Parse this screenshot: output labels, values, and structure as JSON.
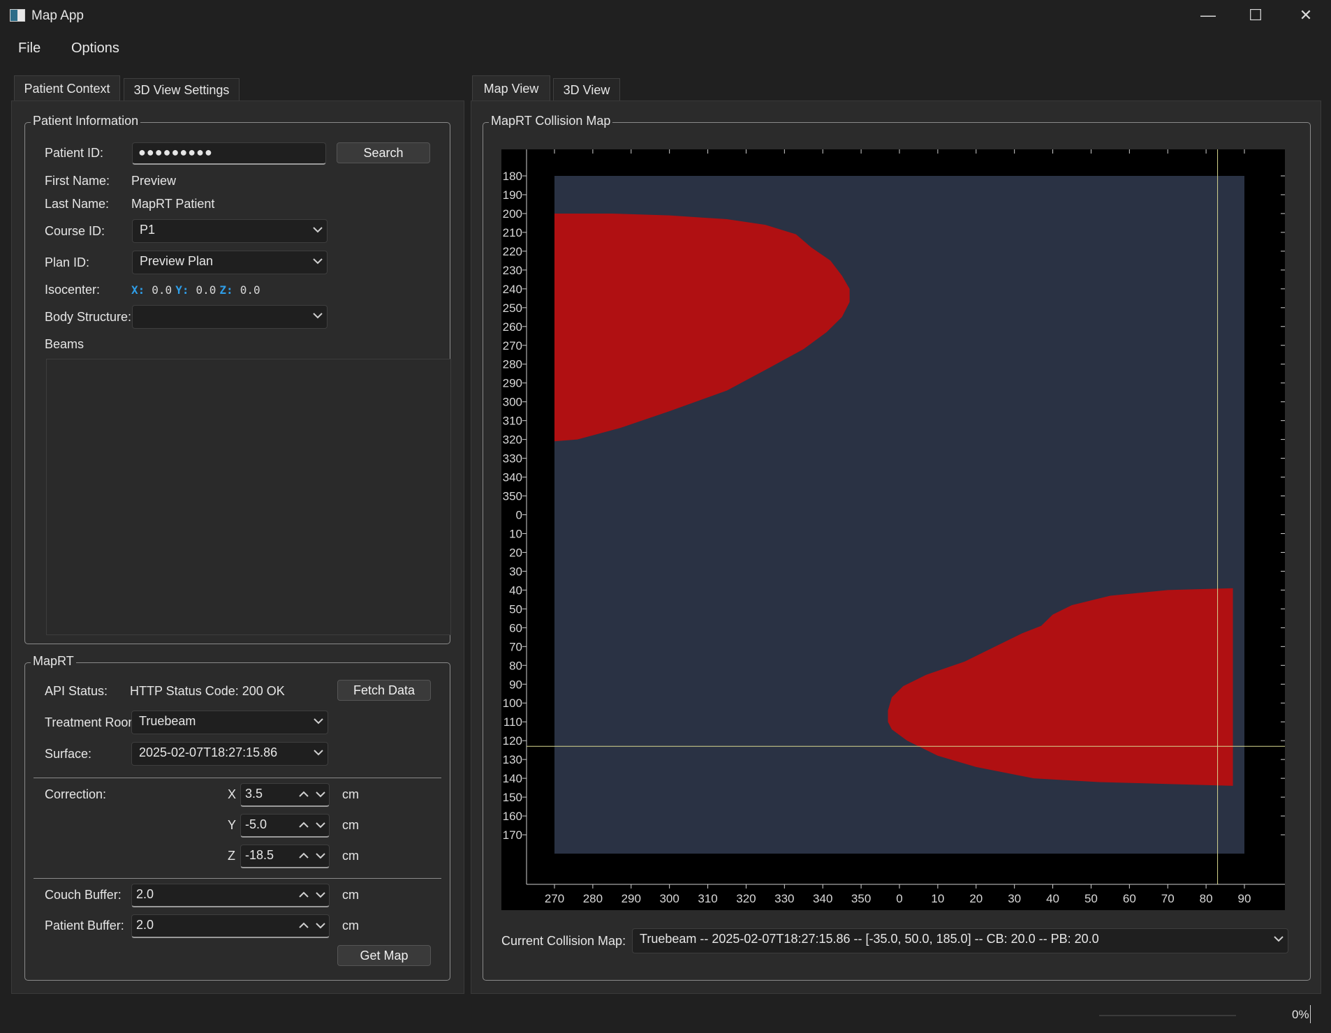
{
  "window": {
    "title": "Map App",
    "controls": {
      "minimize": "—",
      "maximize": "☐",
      "close": "✕"
    }
  },
  "menu": {
    "file": "File",
    "options": "Options"
  },
  "left_tabs": [
    {
      "label": "Patient Context",
      "active": true
    },
    {
      "label": "3D View Settings",
      "active": false
    }
  ],
  "right_tabs": [
    {
      "label": "Map View",
      "active": true
    },
    {
      "label": "3D View",
      "active": false
    }
  ],
  "patient": {
    "group_title": "Patient Information",
    "patient_id_label": "Patient ID:",
    "patient_id_value": "●●●●●●●●●",
    "search_button": "Search",
    "first_name_label": "First Name:",
    "first_name_value": "Preview",
    "last_name_label": "Last Name:",
    "last_name_value": "MapRT Patient",
    "course_id_label": "Course ID:",
    "course_id_value": "P1",
    "plan_id_label": "Plan ID:",
    "plan_id_value": "Preview Plan",
    "isocenter_label": "Isocenter:",
    "iso_x_key": "X:",
    "iso_x": "0.0",
    "iso_y_key": "Y:",
    "iso_y": "0.0",
    "iso_z_key": "Z:",
    "iso_z": "0.0",
    "body_structure_label": "Body Structure:",
    "body_structure_value": "",
    "beams_label": "Beams"
  },
  "maprt": {
    "group_title": "MapRT",
    "api_status_label": "API Status:",
    "api_status_value": "HTTP Status Code: 200 OK",
    "fetch_button": "Fetch Data",
    "room_label": "Treatment Room:",
    "room_value": "Truebeam",
    "surface_label": "Surface:",
    "surface_value": "2025-02-07T18:27:15.86",
    "correction_label": "Correction:",
    "corr_x_label": "X",
    "corr_x": "3.5",
    "corr_y_label": "Y",
    "corr_y": "-5.0",
    "corr_z_label": "Z",
    "corr_z": "-18.5",
    "unit": "cm",
    "couch_buffer_label": "Couch Buffer:",
    "couch_buffer": "2.0",
    "patient_buffer_label": "Patient Buffer:",
    "patient_buffer": "2.0",
    "get_map_button": "Get Map"
  },
  "map": {
    "group_title": "MapRT Collision Map",
    "current_label": "Current Collision Map:",
    "current_value": "Truebeam -- 2025-02-07T18:27:15.86 -- [-35.0, 50.0, 185.0] -- CB: 20.0 -- PB: 20.0"
  },
  "status": {
    "progress": "0%",
    "progress_fraction": 0
  },
  "chart_data": {
    "type": "heatmap",
    "x_tick_labels": [
      "270",
      "280",
      "290",
      "300",
      "310",
      "320",
      "330",
      "340",
      "350",
      "0",
      "10",
      "20",
      "30",
      "40",
      "50",
      "60",
      "70",
      "80",
      "90"
    ],
    "y_tick_labels": [
      "180",
      "190",
      "200",
      "210",
      "220",
      "230",
      "240",
      "250",
      "260",
      "270",
      "280",
      "290",
      "300",
      "310",
      "320",
      "330",
      "340",
      "350",
      "0",
      "10",
      "20",
      "30",
      "40",
      "50",
      "60",
      "70",
      "80",
      "90",
      "100",
      "110",
      "120",
      "130",
      "140",
      "150",
      "160",
      "170"
    ],
    "xlim": [
      270,
      450
    ],
    "ylim": [
      180,
      540
    ],
    "cursor": {
      "x": 83,
      "y": 123
    },
    "colors": {
      "background": "#000000",
      "free": "#2a3244",
      "collision": "#b01012",
      "cursor": "#d8d890",
      "axis": "#d0d0d0"
    },
    "collision_regions": [
      {
        "name": "upper-left",
        "x": [
          270,
          270,
          285,
          300,
          315,
          325,
          333,
          337,
          342,
          345,
          347,
          347,
          345,
          341,
          335,
          326,
          315,
          300,
          287,
          276,
          270
        ],
        "y": [
          200,
          200,
          200,
          201,
          203,
          206,
          211,
          218,
          225,
          233,
          240,
          247,
          255,
          263,
          272,
          282,
          294,
          305,
          314,
          320,
          321
        ]
      },
      {
        "name": "lower-right",
        "x": [
          447,
          447,
          430,
          415,
          405,
          400,
          397,
          392,
          385,
          377,
          367,
          361,
          358,
          357,
          357,
          358,
          362,
          370,
          380,
          395,
          412,
          430,
          447
        ],
        "y": [
          399,
          399,
          400,
          403,
          408,
          413,
          419,
          423,
          430,
          438,
          445,
          451,
          457,
          464,
          470,
          474,
          480,
          488,
          494,
          500,
          502,
          503,
          504
        ]
      }
    ]
  }
}
